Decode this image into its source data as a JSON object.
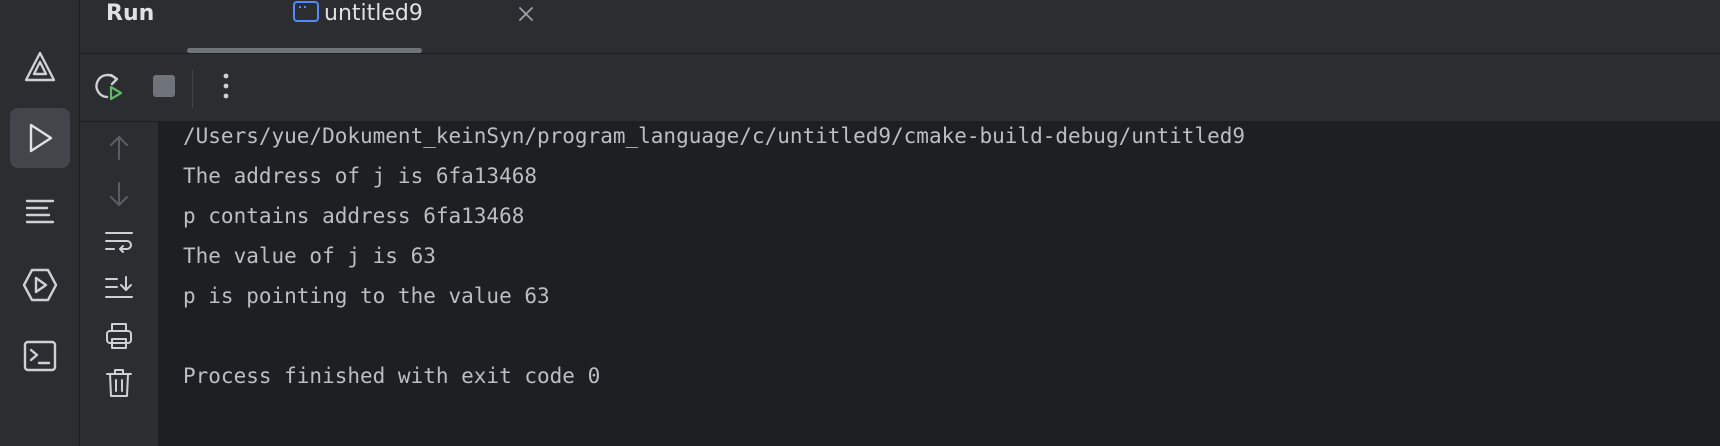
{
  "header": {
    "title": "Run",
    "tab": {
      "label": "untitled9",
      "icon": "console-app-icon",
      "close_icon": "close-icon"
    }
  },
  "left_strip": {
    "items": [
      {
        "name": "build-icon",
        "active": false
      },
      {
        "name": "run-icon",
        "active": true
      },
      {
        "name": "structure-icon",
        "active": false
      },
      {
        "name": "services-icon",
        "active": false
      },
      {
        "name": "terminal-icon",
        "active": false
      }
    ]
  },
  "toolbar": {
    "items": [
      "rerun-icon",
      "stop-icon",
      "more-options-icon"
    ]
  },
  "console_gutter": {
    "items": [
      "up-arrow-icon",
      "down-arrow-icon",
      "soft-wrap-icon",
      "scroll-to-end-icon",
      "print-icon",
      "clear-all-icon"
    ]
  },
  "console": {
    "lines": [
      "/Users/yue/Dokument_keinSyn/program_language/c/untitled9/cmake-build-debug/untitled9",
      "The address of j is 6fa13468",
      "p contains address 6fa13468",
      "The value of j is 63",
      "p is pointing to the value 63",
      "",
      "Process finished with exit code 0"
    ]
  },
  "colors": {
    "panel_bg": "#2b2d30",
    "editor_bg": "#1e1f22",
    "text": "#bcbec4",
    "icon": "#ced0d6",
    "rerun_green": "#5fb865"
  }
}
